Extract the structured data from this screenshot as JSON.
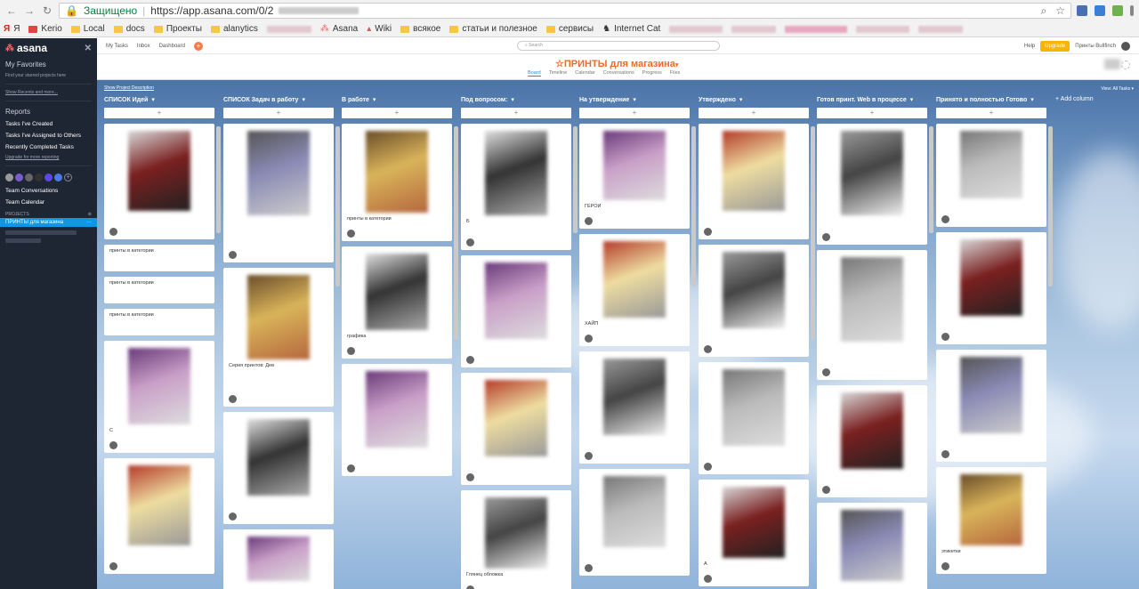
{
  "browser": {
    "secure_label": "Защищено",
    "url": "https://app.asana.com/0/2"
  },
  "bookmarks": [
    "Я",
    "Kerio",
    "Local",
    "docs",
    "Проекты",
    "alanytics",
    "Asana",
    "Wiki",
    "всякое",
    "статьи и полезное",
    "сервисы",
    "Internet Cat"
  ],
  "sidebar": {
    "logo": "asana",
    "favorites_title": "My Favorites",
    "favorites_hint": "Find your starred projects here",
    "show_recents": "Show Recents and more...",
    "reports_title": "Reports",
    "reports": [
      "Tasks I've Created",
      "Tasks I've Assigned to Others",
      "Recently Completed Tasks"
    ],
    "upgrade_link": "Upgrade for more reporting",
    "team_links": [
      "Team Conversations",
      "Team Calendar"
    ],
    "projects_label": "PROJECTS",
    "active_project": "ПРИНТЫ для магазина"
  },
  "topbar": {
    "links": [
      "My Tasks",
      "Inbox",
      "Dashboard"
    ],
    "search_placeholder": "Search",
    "help": "Help",
    "upgrade": "Upgrade",
    "user": "Принты Bullfinch"
  },
  "project": {
    "title": "ПРИНТЫ для магазина",
    "tabs": [
      "Board",
      "Timeline",
      "Calendar",
      "Conversations",
      "Progress",
      "Files"
    ],
    "active_tab": "Board"
  },
  "board": {
    "show_description": "Show Project Description",
    "view_all": "View: All Tasks",
    "add_column": "+ Add column",
    "columns": [
      {
        "name": "СПИСОК Идей",
        "cards": [
          "",
          "принты в категории",
          "принты в категории",
          "принты в категории",
          "С",
          ""
        ]
      },
      {
        "name": "СПИСОК Задач в работу",
        "cards": [
          "",
          "Серия принтов: Дев",
          "",
          ""
        ]
      },
      {
        "name": "В работе",
        "cards": [
          "принты в категории",
          "графика",
          ""
        ]
      },
      {
        "name": "Под вопросом:",
        "cards": [
          "Б",
          "",
          "",
          "Глянец обложка"
        ]
      },
      {
        "name": "На утверждение",
        "cards": [
          "ГЕРОИ",
          "ХАЙП",
          "",
          ""
        ]
      },
      {
        "name": "Утверждено",
        "cards": [
          "",
          "",
          "",
          "А"
        ]
      },
      {
        "name": "Готов принт. Web в процессе",
        "cards": [
          "",
          "",
          "",
          ""
        ]
      },
      {
        "name": "Принято и полностью Готово",
        "cards": [
          "",
          "",
          "",
          "этикетки"
        ]
      }
    ]
  }
}
